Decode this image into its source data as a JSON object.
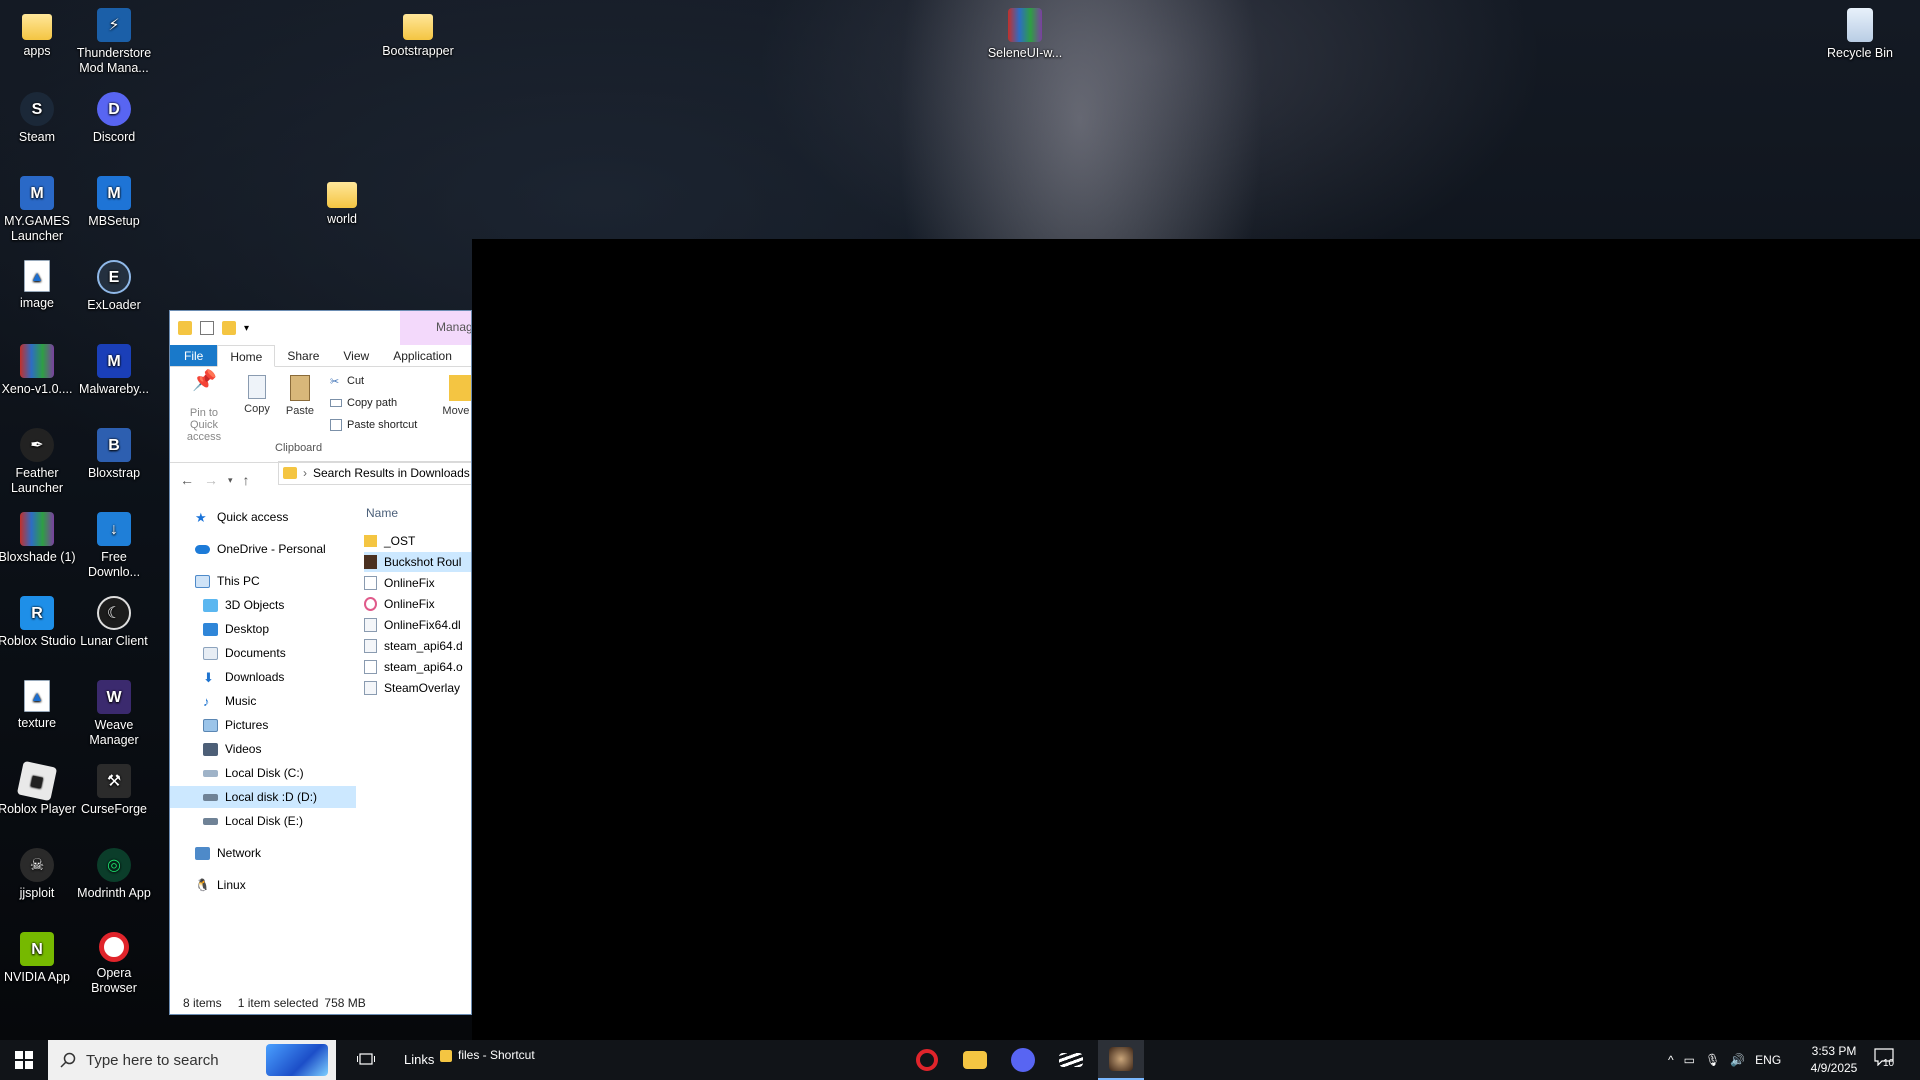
{
  "desktop": {
    "icons": [
      {
        "label": "apps",
        "icon": "folder-icon"
      },
      {
        "label": "Thunderstore Mod Mana...",
        "icon": "thunderstore-icon"
      },
      {
        "label": "Bootstrapper",
        "icon": "folder-icon"
      },
      {
        "label": "SeleneUI-w...",
        "icon": "winrar-archive-icon"
      },
      {
        "label": "Recycle Bin",
        "icon": "recycle-bin-icon"
      },
      {
        "label": "Steam",
        "icon": "steam-icon"
      },
      {
        "label": "Discord",
        "icon": "discord-icon"
      },
      {
        "label": "MY.GAMES Launcher",
        "icon": "mygames-icon"
      },
      {
        "label": "MBSetup",
        "icon": "mbsetup-icon"
      },
      {
        "label": "world",
        "icon": "folder-icon"
      },
      {
        "label": "image",
        "icon": "image-file-icon"
      },
      {
        "label": "ExLoader",
        "icon": "exloader-icon"
      },
      {
        "label": "Xeno-v1.0....",
        "icon": "winrar-archive-icon"
      },
      {
        "label": "Malwareby...",
        "icon": "malwarebytes-icon"
      },
      {
        "label": "Feather Launcher",
        "icon": "feather-icon"
      },
      {
        "label": "Bloxstrap",
        "icon": "bloxstrap-icon"
      },
      {
        "label": "Bloxshade (1)",
        "icon": "winrar-archive-icon"
      },
      {
        "label": "Free Downlo...",
        "icon": "free-download-manager-icon"
      },
      {
        "label": "Roblox Studio",
        "icon": "roblox-studio-icon"
      },
      {
        "label": "Lunar Client",
        "icon": "lunar-client-icon"
      },
      {
        "label": "texture",
        "icon": "image-file-icon"
      },
      {
        "label": "Weave Manager",
        "icon": "weave-icon"
      },
      {
        "label": "Roblox Player",
        "icon": "roblox-player-icon"
      },
      {
        "label": "CurseForge",
        "icon": "curseforge-icon"
      },
      {
        "label": "jjsploit",
        "icon": "jjsploit-icon"
      },
      {
        "label": "Modrinth App",
        "icon": "modrinth-icon"
      },
      {
        "label": "NVIDIA App",
        "icon": "nvidia-icon"
      },
      {
        "label": "Opera Browser",
        "icon": "opera-icon"
      }
    ]
  },
  "explorer": {
    "manage_tab": "Manag",
    "ribbon_tabs": [
      "File",
      "Home",
      "Share",
      "View",
      "Application"
    ],
    "ribbon": {
      "pin_label": "Pin to Quick access",
      "copy_label": "Copy",
      "paste_label": "Paste",
      "cut_label": "Cut",
      "copy_path_label": "Copy path",
      "paste_shortcut_label": "Paste shortcut",
      "move_to_label": "Move to",
      "group_label": "Clipboard"
    },
    "address": "Search Results in Downloads",
    "nav": {
      "quick_access": "Quick access",
      "onedrive": "OneDrive - Personal",
      "this_pc": "This PC",
      "objects3d": "3D Objects",
      "desktop": "Desktop",
      "documents": "Documents",
      "downloads": "Downloads",
      "music": "Music",
      "pictures": "Pictures",
      "videos": "Videos",
      "disk_c": "Local Disk (C:)",
      "disk_d": "Local disk :D (D:)",
      "disk_e": "Local Disk (E:)",
      "network": "Network",
      "linux": "Linux"
    },
    "column_name": "Name",
    "files": [
      "_OST",
      "Buckshot Roul",
      "OnlineFix",
      "OnlineFix",
      "OnlineFix64.dl",
      "steam_api64.d",
      "steam_api64.o",
      "SteamOverlay"
    ],
    "status": {
      "items": "8 items",
      "selected": "1 item selected",
      "size": "758 MB"
    }
  },
  "taskbar": {
    "search_placeholder": "Type here to search",
    "links_label": "Links",
    "shortcut_label": "files - Shortcut",
    "language": "ENG",
    "time": "3:53 PM",
    "date": "4/9/2025",
    "notification_count": "10"
  },
  "colors": {
    "accent": "#1979ca",
    "selection": "#cce8ff",
    "folder": "#f4c542"
  }
}
